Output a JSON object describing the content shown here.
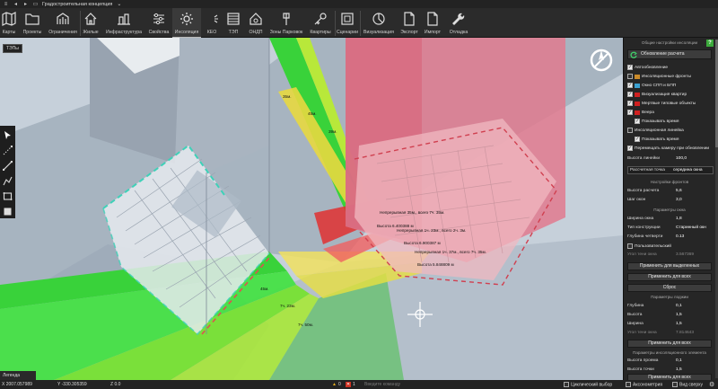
{
  "window": {
    "title": "Градостроительная концепция"
  },
  "toolbar": {
    "buttons": [
      {
        "label": "Карты",
        "icon": "map-icon"
      },
      {
        "label": "Проекты",
        "icon": "folder-icon"
      },
      {
        "label": "Ограничения",
        "icon": "restriction-icon"
      },
      {
        "label": "Жилые",
        "icon": "house-icon"
      },
      {
        "label": "Инфраструктура",
        "icon": "infrastructure-icon"
      },
      {
        "label": "Свойства",
        "icon": "sliders-icon"
      },
      {
        "label": "Инсоляция",
        "icon": "sun-icon"
      },
      {
        "label": "КЕО",
        "icon": "keo-icon"
      },
      {
        "label": "ТЭП",
        "icon": "table-icon"
      },
      {
        "label": "ОНДП",
        "icon": "home-shield-icon"
      },
      {
        "label": "Зоны Парковок",
        "icon": "parking-icon"
      },
      {
        "label": "Квартиры",
        "icon": "key-icon"
      },
      {
        "label": "Сценарии",
        "icon": "scenario-icon"
      },
      {
        "label": "Визуализация",
        "icon": "visualization-icon"
      },
      {
        "label": "Экспорт",
        "icon": "export-icon"
      },
      {
        "label": "Импорт",
        "icon": "import-icon"
      },
      {
        "label": "Отладка",
        "icon": "wrench-icon"
      }
    ],
    "active": "Инсоляция"
  },
  "viewport": {
    "tooltip": "ТЭПы",
    "legend_label": "Легенда",
    "labels": [
      "Непрерывная 35м., всего 7ч. 35м.",
      "Высота 6.400388 м",
      "Непрерывная 1ч. 23м., всего 2ч. 3м.",
      "Высота 6.900387 м",
      "Непрерывная 1ч. 37м., всего 7ч. 35м.",
      "Высота 5.848809 м",
      "35м.",
      "45м.",
      "39м.",
      "45м.",
      "7ч. 23м.",
      "7ч. 50м."
    ]
  },
  "panel": {
    "header": "Общие настройки инсоляции",
    "update_button": "Обновление расчета",
    "checks": [
      {
        "label": "Автообновление",
        "checked": true,
        "swatch": ""
      },
      {
        "label": "Инсоляционные фронты",
        "checked": false,
        "swatch": "#c98a2a"
      },
      {
        "label": "Окно СПП и БПП",
        "checked": true,
        "swatch": "#3aa0d0"
      },
      {
        "label": "Визуализация квартир",
        "checked": true,
        "swatch": "#d02020"
      },
      {
        "label": "Мертвые типовые объекты",
        "checked": true,
        "swatch": "#d02020"
      },
      {
        "label": "Веера",
        "checked": true,
        "swatch": "#d02020"
      },
      {
        "label": "Показывать время",
        "checked": true,
        "swatch": ""
      },
      {
        "label": "Инсоляционная линейка",
        "checked": false,
        "swatch": ""
      },
      {
        "label": "Показывать время",
        "checked": true,
        "swatch": ""
      },
      {
        "label": "Перемещать камеру при обновлении",
        "checked": true,
        "swatch": ""
      }
    ],
    "ruler_height_label": "Высота линейки",
    "ruler_height_value": "100,0",
    "calc_point_label": "Рассчетная точка",
    "calc_point_value": "середина окна",
    "fronts_header": "Настройки фронтов",
    "calc_height_label": "Высота расчета",
    "calc_height_value": "5,6",
    "window_step_label": "Шаг окон",
    "window_step_value": "3,0",
    "window_params_header": "Параметры окна",
    "window_width_label": "Ширина окна",
    "window_width_value": "1,8",
    "construction_type_label": "Тип конструкции",
    "construction_type_value": "Старинный окн",
    "quarter_depth_label": "Глубина четверти",
    "quarter_depth_value": "0.13",
    "custom_label": "Пользовательский",
    "shade_angle_label": "Угол тени окна",
    "shade_angle_value": "3.567369",
    "apply_selected_button": "Применить для выделенных",
    "apply_all_button": "Применить для всех",
    "reset_button": "Сброс",
    "loggia_header": "Параметры лоджии",
    "depth_label": "Глубина",
    "depth_value": "0,1",
    "height_label": "Высота",
    "height_value": "1,5",
    "width_label": "Ширина",
    "width_value": "1,5",
    "shade_angle2_label": "Угол тени окна",
    "shade_angle2_value": "7.814643",
    "apply_all_button2": "Применить для всех",
    "element_header": "Параметры инсоляционного элемента",
    "opening_height_label": "Высота проема",
    "opening_height_value": "0,1",
    "point_height_label": "Высота точки",
    "point_height_value": "1,5",
    "apply_all_button3": "Применить для всех"
  },
  "statusbar": {
    "x": "X 2007.057989",
    "y": "Y -330.305359",
    "z": "Z 0.0",
    "warnings": "0",
    "errors": "1",
    "command_placeholder": "Введите команду",
    "cyclic_select": "Циклический выбор",
    "axonometry": "Аксонометрия",
    "top_view": "Вид сверху",
    "colors": {
      "warning": "#e8b020",
      "error": "#d03020"
    }
  }
}
